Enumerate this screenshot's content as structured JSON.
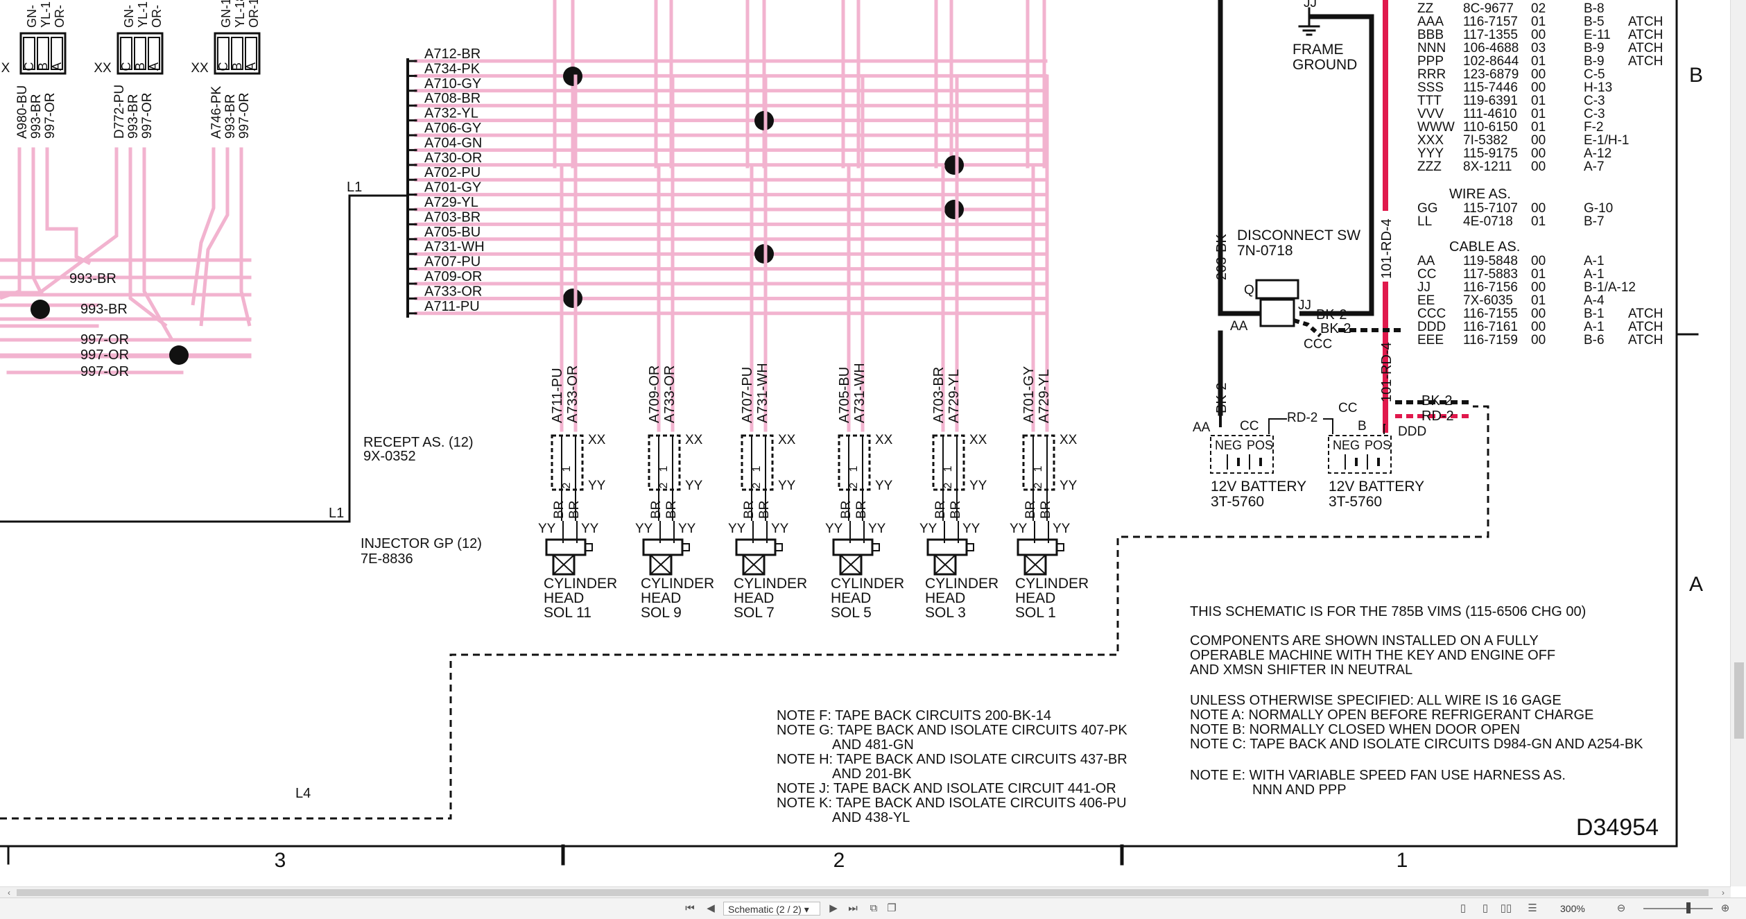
{
  "app": {
    "page_selector": "Schematic (2 / 2)",
    "zoom": "300%",
    "icons": [
      "first-page-icon",
      "prev-page-icon",
      "next-page-icon",
      "last-page-icon",
      "page-layout-icon",
      "zoom-out-icon",
      "zoom-in-icon"
    ]
  },
  "diagram": {
    "drawing_number": "D34954",
    "zones": {
      "row_b": "B",
      "row_a": "A",
      "col_3": "3",
      "col_2": "2",
      "col_1": "1"
    },
    "left_connectors": [
      {
        "top": "GN-",
        "pins": [
          "C",
          "B",
          "A"
        ],
        "wires": [
          "A980-BU",
          "993-BR",
          "997-OR"
        ],
        "extra_top": [
          "YL-1",
          "OR-"
        ]
      },
      {
        "top": "GN-",
        "pins": [
          "C",
          "B",
          "A"
        ],
        "wires": [
          "D772-PU",
          "993-BR",
          "997-OR"
        ],
        "extra_top": [
          "YL-1",
          "OR-"
        ]
      },
      {
        "top": "GN-18",
        "pins": [
          "C",
          "B",
          "A"
        ],
        "wires": [
          "A746-PK",
          "993-BR",
          "997-OR"
        ],
        "extra_top": [
          "YL-18",
          "OR-18"
        ]
      }
    ],
    "xx_labels": [
      "X",
      "XX",
      "XX"
    ],
    "left_wire_labels": [
      "993-BR",
      "993-BR",
      "997-OR",
      "997-OR",
      "997-OR"
    ],
    "bus_label": "L1",
    "bus_label_2": "L1",
    "bus_label_l4": "L4",
    "bundle_wires": [
      "A712-BR",
      "A734-PK",
      "A710-GY",
      "A708-BR",
      "A732-YL",
      "A706-GY",
      "A704-GN",
      "A730-OR",
      "A702-PU",
      "A701-GY",
      "A729-YL",
      "A703-BR",
      "A705-BU",
      "A731-WH",
      "A707-PU",
      "A709-OR",
      "A733-OR",
      "A711-PU"
    ],
    "receptacle": {
      "name": "RECEPT AS. (12)",
      "part": "9X-0352"
    },
    "injector": {
      "name": "INJECTOR GP (12)",
      "part": "7E-8836"
    },
    "injectors": [
      {
        "wires": [
          "A711-PU",
          "A733-OR"
        ],
        "label": [
          "CYLINDER",
          "HEAD",
          "SOL 11"
        ]
      },
      {
        "wires": [
          "A709-OR",
          "A733-OR"
        ],
        "label": [
          "CYLINDER",
          "HEAD",
          "SOL 9"
        ]
      },
      {
        "wires": [
          "A707-PU",
          "A731-WH"
        ],
        "label": [
          "CYLINDER",
          "HEAD",
          "SOL 7"
        ]
      },
      {
        "wires": [
          "A705-BU",
          "A731-WH"
        ],
        "label": [
          "CYLINDER",
          "HEAD",
          "SOL 5"
        ]
      },
      {
        "wires": [
          "A703-BR",
          "A729-YL"
        ],
        "label": [
          "CYLINDER",
          "HEAD",
          "SOL 3"
        ]
      },
      {
        "wires": [
          "A701-GY",
          "A729-YL"
        ],
        "label": [
          "CYLINDER",
          "HEAD",
          "SOL 1"
        ]
      }
    ],
    "inj_small": {
      "xx": "XX",
      "yy": "YY",
      "br": "BR",
      "pin1": "1",
      "pin2": "2",
      "yyi": "YY",
      "iyy": "YY"
    },
    "frame_ground": [
      "FRAME",
      "GROUND"
    ],
    "jj": "JJ",
    "disconnect": {
      "name": "DISCONNECT SW",
      "part": "7N-0718"
    },
    "power_wires": {
      "bk203": "203-BK",
      "rd101a": "101-RD-4",
      "rd101b": "101-RD-4",
      "bk2a": "BK-2",
      "bk2b": "BK-2",
      "bk2c": "BK-2",
      "bk2d": "BK-2",
      "rd2a": "RD-2",
      "rd2b": "RD-2"
    },
    "switch_labels": {
      "q": "Q",
      "aa": "AA",
      "jj": "JJ",
      "ccc": "CCC"
    },
    "battery_labels": {
      "aa": "AA",
      "cc1": "CC",
      "cc2": "CC",
      "b": "B",
      "ddd": "DDD"
    },
    "batteries": [
      {
        "name": "12V BATTERY",
        "part": "3T-5760",
        "neg": "NEG",
        "pos": "POS"
      },
      {
        "name": "12V BATTERY",
        "part": "3T-5760",
        "neg": "NEG",
        "pos": "POS"
      }
    ],
    "parts_table_1": [
      [
        "ZZ",
        "8C-9677",
        "02",
        "B-8",
        ""
      ],
      [
        "AAA",
        "116-7157",
        "01",
        "B-5",
        "ATCH"
      ],
      [
        "BBB",
        "117-1355",
        "00",
        "E-11",
        "ATCH"
      ],
      [
        "NNN",
        "106-4688",
        "03",
        "B-9",
        "ATCH"
      ],
      [
        "PPP",
        "102-8644",
        "01",
        "B-9",
        "ATCH"
      ],
      [
        "RRR",
        "123-6879",
        "00",
        "C-5",
        ""
      ],
      [
        "SSS",
        "115-7446",
        "00",
        "H-13",
        ""
      ],
      [
        "TTT",
        "119-6391",
        "01",
        "C-3",
        ""
      ],
      [
        "VVV",
        "111-4610",
        "01",
        "C-3",
        ""
      ],
      [
        "WWW",
        "110-6150",
        "01",
        "F-2",
        ""
      ],
      [
        "XXX",
        "7I-5382",
        "00",
        "E-1/H-1",
        ""
      ],
      [
        "YYY",
        "115-9175",
        "00",
        "A-12",
        ""
      ],
      [
        "ZZZ",
        "8X-1211",
        "00",
        "A-7",
        ""
      ]
    ],
    "wire_as_title": "WIRE AS.",
    "wire_as": [
      [
        "GG",
        "115-7107",
        "00",
        "G-10",
        ""
      ],
      [
        "LL",
        "4E-0718",
        "01",
        "B-7",
        ""
      ]
    ],
    "cable_as_title": "CABLE AS.",
    "cable_as": [
      [
        "AA",
        "119-5848",
        "00",
        "A-1",
        ""
      ],
      [
        "CC",
        "117-5883",
        "01",
        "A-1",
        ""
      ],
      [
        "JJ",
        "116-7156",
        "00",
        "B-1/A-12",
        ""
      ],
      [
        "EE",
        "7X-6035",
        "01",
        "A-4",
        ""
      ],
      [
        "CCC",
        "116-7155",
        "00",
        "B-1",
        "ATCH"
      ],
      [
        "DDD",
        "116-7161",
        "00",
        "A-1",
        "ATCH"
      ],
      [
        "EEE",
        "116-7159",
        "00",
        "B-6",
        "ATCH"
      ]
    ],
    "notes_right": [
      "THIS SCHEMATIC IS FOR THE 785B VIMS (115-6506 CHG 00)",
      "COMPONENTS ARE SHOWN INSTALLED ON A FULLY",
      "OPERABLE MACHINE WITH THE KEY AND ENGINE OFF",
      "AND XMSN SHIFTER IN NEUTRAL",
      "UNLESS OTHERWISE SPECIFIED: ALL WIRE IS 16 GAGE",
      "NOTE A: NORMALLY OPEN BEFORE REFRIGERANT CHARGE",
      "NOTE B: NORMALLY CLOSED WHEN DOOR OPEN",
      "NOTE C: TAPE BACK AND ISOLATE CIRCUITS D984-GN AND A254-BK",
      "NOTE E: WITH VARIABLE SPEED FAN USE HARNESS AS.",
      "NNN AND PPP"
    ],
    "notes_mid": [
      "NOTE F: TAPE BACK CIRCUITS 200-BK-14",
      "NOTE G: TAPE BACK AND ISOLATE CIRCUITS 407-PK",
      "AND 481-GN",
      "NOTE H: TAPE BACK AND ISOLATE CIRCUITS 437-BR",
      "AND 201-BK",
      "NOTE J: TAPE BACK AND ISOLATE CIRCUIT 441-OR",
      "NOTE K: TAPE BACK AND ISOLATE CIRCUITS 406-PU",
      "AND 438-YL"
    ],
    "colors": {
      "pink_wire": "#f2b3cf",
      "red_wire": "#e0194c",
      "black": "#111111"
    }
  }
}
